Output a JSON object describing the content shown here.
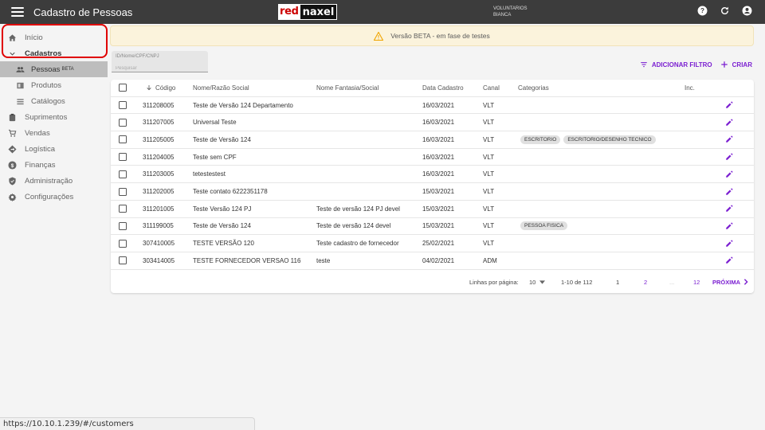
{
  "header": {
    "title": "Cadastro de Pessoas",
    "logo_red": "red",
    "logo_black": "naxel",
    "user_org": "VOLUNTARIOS",
    "user_name": "BIANCA",
    "icons": [
      "help-icon",
      "refresh-icon",
      "account-icon"
    ]
  },
  "sidebar": {
    "items": [
      {
        "label": "Início",
        "icon": "home-icon"
      },
      {
        "label": "Cadastros",
        "icon": "chevron-down-icon"
      },
      {
        "label": "Pessoas",
        "badge": "BETA",
        "icon": "people-icon"
      },
      {
        "label": "Produtos",
        "icon": "box-icon"
      },
      {
        "label": "Catálogos",
        "icon": "list-icon"
      },
      {
        "label": "Suprimentos",
        "icon": "clipboard-icon"
      },
      {
        "label": "Vendas",
        "icon": "cart-icon"
      },
      {
        "label": "Logística",
        "icon": "route-icon"
      },
      {
        "label": "Finanças",
        "icon": "dollar-icon"
      },
      {
        "label": "Administração",
        "icon": "shield-icon"
      },
      {
        "label": "Configurações",
        "icon": "gear-icon"
      }
    ]
  },
  "banner": {
    "text": "Versão BETA - em fase de testes"
  },
  "search": {
    "label": "ID/Nome/CPF/CNPJ",
    "placeholder": "Pesquisar"
  },
  "actions": {
    "filter": "ADICIONAR FILTRO",
    "create": "CRIAR"
  },
  "table": {
    "headers": {
      "code": "Código",
      "name": "Nome/Razão Social",
      "fantasy": "Nome Fantasia/Social",
      "date": "Data Cadastro",
      "channel": "Canal",
      "categories": "Categorias",
      "inc": "Inc."
    },
    "rows": [
      {
        "code": "311208005",
        "name": "Teste de Versão 124 Departamento",
        "fantasy": "",
        "date": "16/03/2021",
        "channel": "VLT",
        "categories": []
      },
      {
        "code": "311207005",
        "name": "Universal Teste",
        "fantasy": "",
        "date": "16/03/2021",
        "channel": "VLT",
        "categories": []
      },
      {
        "code": "311205005",
        "name": "Teste de Versão 124",
        "fantasy": "",
        "date": "16/03/2021",
        "channel": "VLT",
        "categories": [
          "ESCRITORIO",
          "ESCRITORIO/DESENHO TECNICO"
        ]
      },
      {
        "code": "311204005",
        "name": "Teste sem CPF",
        "fantasy": "",
        "date": "16/03/2021",
        "channel": "VLT",
        "categories": []
      },
      {
        "code": "311203005",
        "name": "tetestestest",
        "fantasy": "",
        "date": "16/03/2021",
        "channel": "VLT",
        "categories": []
      },
      {
        "code": "311202005",
        "name": "Teste contato 6222351178",
        "fantasy": "",
        "date": "15/03/2021",
        "channel": "VLT",
        "categories": []
      },
      {
        "code": "311201005",
        "name": "Teste Versão 124 PJ",
        "fantasy": "Teste de versão 124 PJ devel",
        "date": "15/03/2021",
        "channel": "VLT",
        "categories": []
      },
      {
        "code": "311199005",
        "name": "Teste de Versão 124",
        "fantasy": "Teste de versão 124 devel",
        "date": "15/03/2021",
        "channel": "VLT",
        "categories": [
          "PESSOA FISICA"
        ]
      },
      {
        "code": "307410005",
        "name": "TESTE VERSÃO 120",
        "fantasy": "Teste cadastro de fornecedor",
        "date": "25/02/2021",
        "channel": "VLT",
        "categories": []
      },
      {
        "code": "303414005",
        "name": "TESTE FORNECEDOR VERSAO 116",
        "fantasy": "teste",
        "date": "04/02/2021",
        "channel": "ADM",
        "categories": []
      }
    ]
  },
  "pagination": {
    "rows_label": "Linhas por página:",
    "rows_value": "10",
    "range": "1-10 de 112",
    "pages": [
      "1",
      "2",
      "...",
      "12"
    ],
    "next": "PRÓXIMA"
  },
  "statusbar": {
    "url": "https://10.10.1.239/#/customers"
  },
  "colors": {
    "accent": "#7b1fd1",
    "topbar": "#3c3c3c",
    "highlight": "#e00000",
    "banner_bg": "#fbf3dc"
  }
}
